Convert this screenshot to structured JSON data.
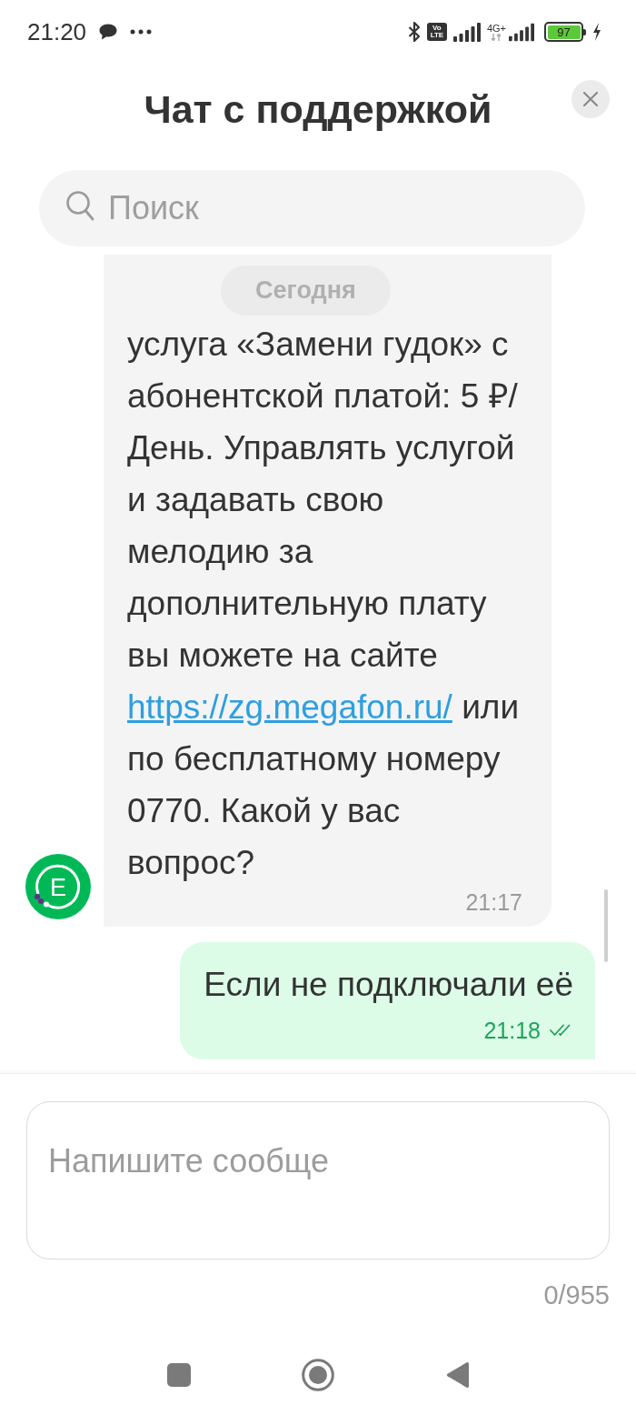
{
  "status_bar": {
    "time": "21:20",
    "volte": [
      "Vo",
      "LTE"
    ],
    "network": "4G+",
    "battery": "97"
  },
  "header": {
    "title": "Чат с поддержкой"
  },
  "search": {
    "placeholder": "Поиск"
  },
  "date_divider": "Сегодня",
  "messages": [
    {
      "kind": "incoming",
      "avatar": "E",
      "parts": [
        {
          "kind": "text",
          "text": "услуга «Замени гудок» с абонентской платой: 5 ₽/День. Управлять услугой и задавать свою мелодию за дополнительную плату вы можете на сайте "
        },
        {
          "kind": "link",
          "text": "https://zg.megafon.ru/"
        },
        {
          "kind": "text",
          "text": " или по бесплатному номеру 0770. Какой у вас вопрос?"
        }
      ],
      "time": "21:17"
    },
    {
      "kind": "outgoing",
      "parts": [
        {
          "kind": "text",
          "text": "Если не подключали её"
        }
      ],
      "time": "21:18",
      "read": true
    }
  ],
  "composer": {
    "placeholder": "Напишите сообще",
    "counter": "0/955"
  }
}
